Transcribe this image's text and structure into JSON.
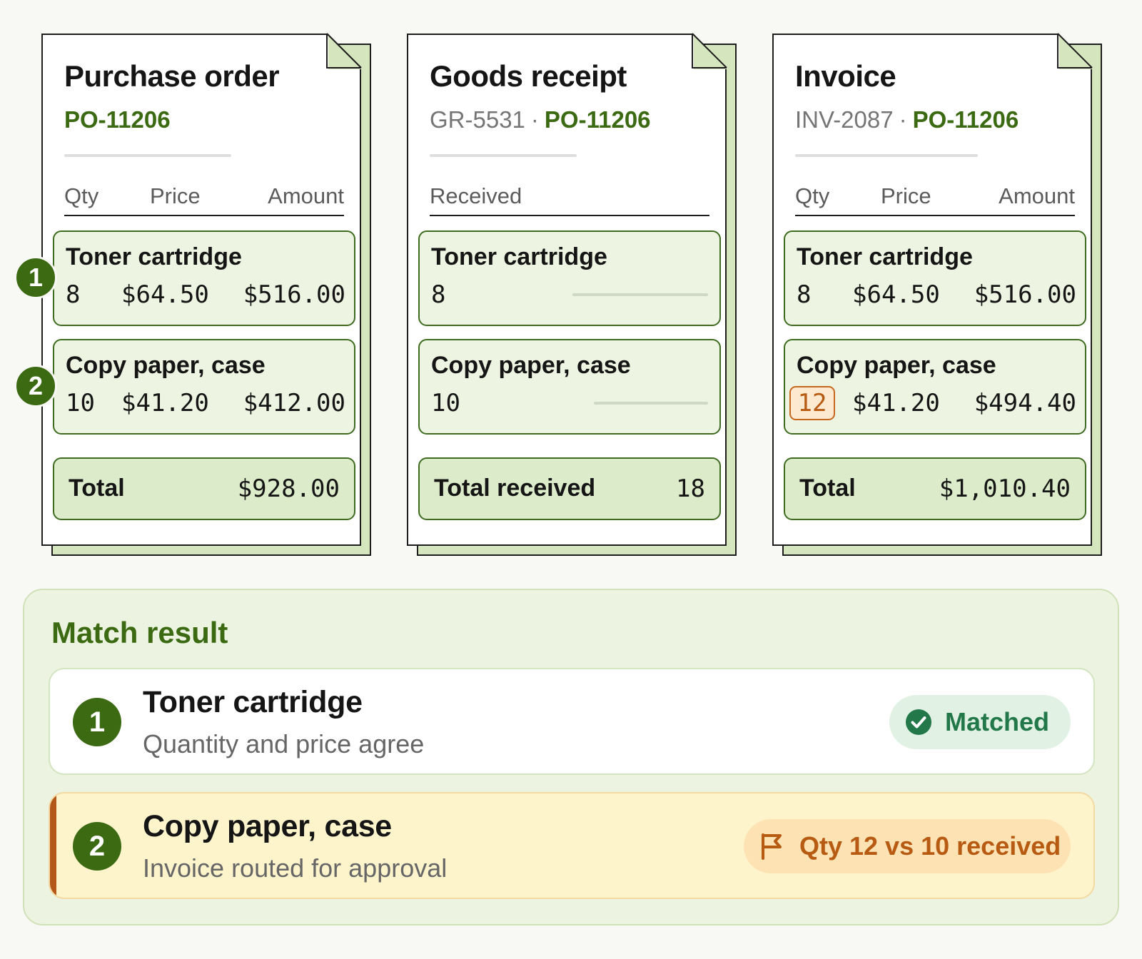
{
  "documents": {
    "purchase_order": {
      "title": "Purchase order",
      "ref": "PO-11206",
      "columns": {
        "qty": "Qty",
        "price": "Price",
        "amount": "Amount"
      },
      "lines": [
        {
          "name": "Toner cartridge",
          "qty": "8",
          "price": "$64.50",
          "amount": "$516.00"
        },
        {
          "name": "Copy paper, case",
          "qty": "10",
          "price": "$41.20",
          "amount": "$412.00"
        }
      ],
      "total_label": "Total",
      "total_value": "$928.00"
    },
    "goods_receipt": {
      "title": "Goods receipt",
      "id": "GR-5531",
      "separator": "·",
      "ref": "PO-11206",
      "columns": {
        "received": "Received"
      },
      "lines": [
        {
          "name": "Toner cartridge",
          "qty": "8"
        },
        {
          "name": "Copy paper, case",
          "qty": "10"
        }
      ],
      "total_label": "Total received",
      "total_value": "18"
    },
    "invoice": {
      "title": "Invoice",
      "id": "INV-2087",
      "separator": "·",
      "ref": "PO-11206",
      "columns": {
        "qty": "Qty",
        "price": "Price",
        "amount": "Amount"
      },
      "lines": [
        {
          "name": "Toner cartridge",
          "qty": "8",
          "price": "$64.50",
          "amount": "$516.00"
        },
        {
          "name": "Copy paper, case",
          "qty": "12",
          "price": "$41.20",
          "amount": "$494.40"
        }
      ],
      "total_label": "Total",
      "total_value": "$1,010.40"
    }
  },
  "line_markers": [
    "1",
    "2"
  ],
  "match_result": {
    "title": "Match result",
    "rows": [
      {
        "number": "1",
        "name": "Toner cartridge",
        "description": "Quantity and price agree",
        "status": "Matched",
        "status_icon": "check-circle-icon"
      },
      {
        "number": "2",
        "name": "Copy paper, case",
        "description": "Invoice routed for approval",
        "status": "Qty 12 vs 10 received",
        "status_icon": "flag-icon"
      }
    ]
  },
  "colors": {
    "brand_green": "#3b6a12",
    "line_fill": "#edf5e2",
    "total_fill": "#dcebc9",
    "matched_text": "#23784a",
    "warning_text": "#b75a12",
    "warning_fill": "#fef4cc"
  }
}
